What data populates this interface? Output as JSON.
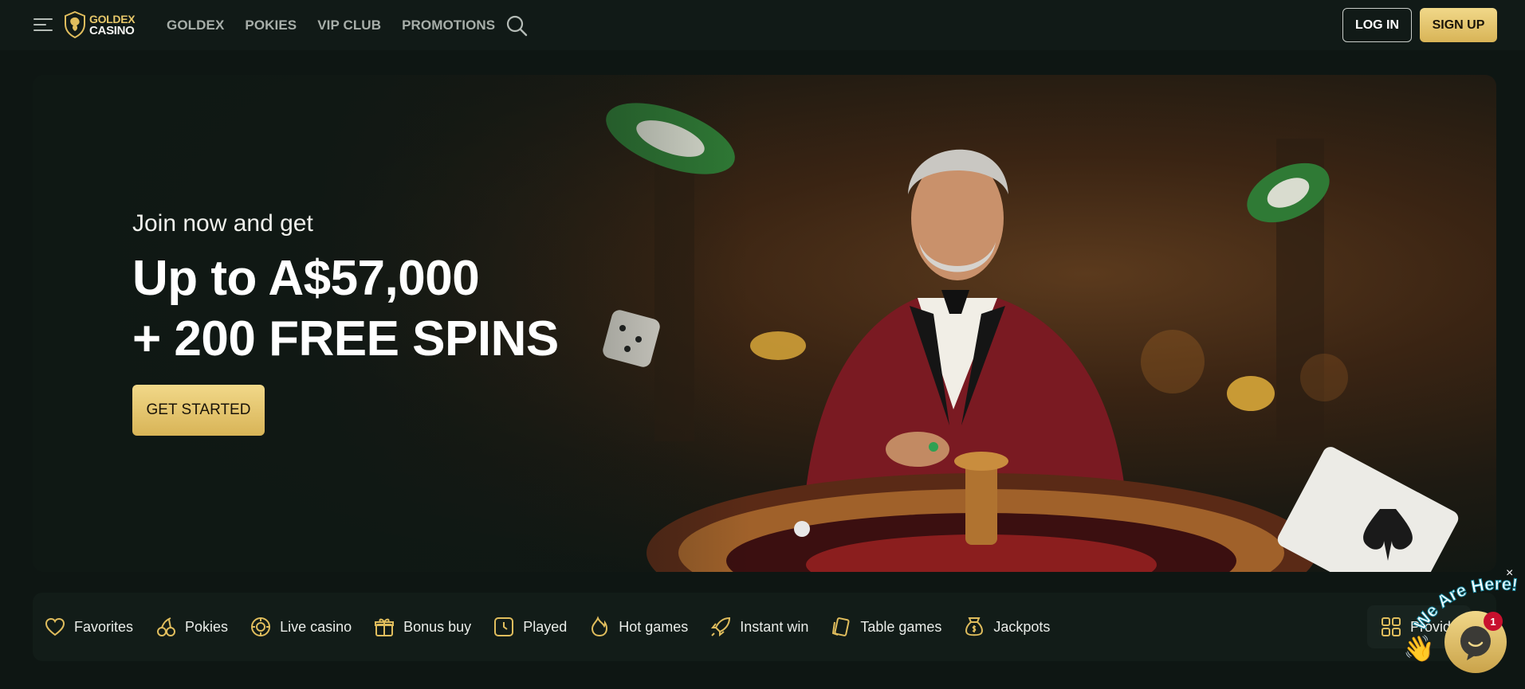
{
  "header": {
    "logo_top": "GOLDEX",
    "logo_bottom": "CASINO",
    "nav": [
      "GOLDEX",
      "POKIES",
      "VIP CLUB",
      "PROMOTIONS"
    ],
    "login_label": "LOG IN",
    "signup_label": "SIGN UP"
  },
  "hero": {
    "subtitle": "Join now and get",
    "title_line1": "Up to A$57,000",
    "title_line2": "+ 200 FREE SPINS",
    "cta_label": "GET STARTED"
  },
  "categories": [
    {
      "label": "Favorites",
      "icon": "heart-icon"
    },
    {
      "label": "Pokies",
      "icon": "cherries-icon"
    },
    {
      "label": "Live casino",
      "icon": "chip-icon"
    },
    {
      "label": "Bonus buy",
      "icon": "gift-icon"
    },
    {
      "label": "Played",
      "icon": "clock-icon"
    },
    {
      "label": "Hot games",
      "icon": "flame-icon"
    },
    {
      "label": "Instant win",
      "icon": "rocket-icon"
    },
    {
      "label": "Table games",
      "icon": "cards-icon"
    },
    {
      "label": "Jackpots",
      "icon": "money-bag-icon"
    }
  ],
  "providers": {
    "label": "Provid",
    "icon": "grid-icon"
  },
  "chat": {
    "banner_text": "We Are Here!",
    "badge_count": "1",
    "close_glyph": "×"
  },
  "colors": {
    "background": "#0e1613",
    "gold_accent": "#e8c86a",
    "nav_text": "#a7aea9",
    "badge_red": "#c8102e"
  }
}
